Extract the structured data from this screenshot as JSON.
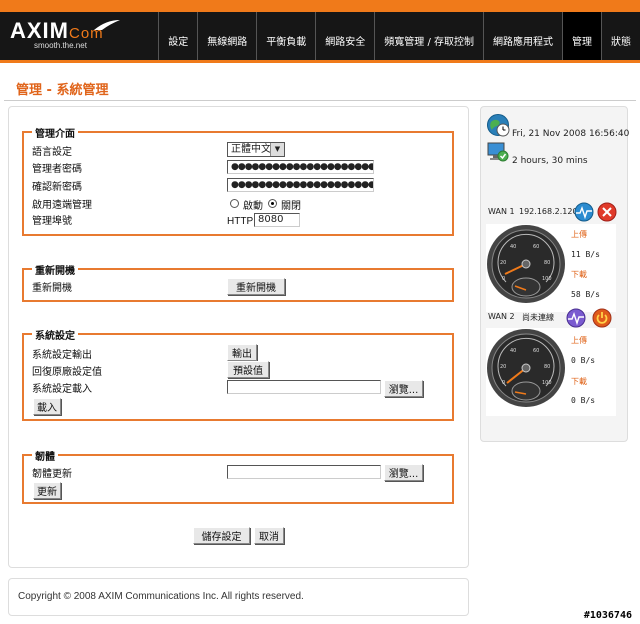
{
  "brand": {
    "name": "AXIM",
    "suffix": "Com",
    "tagline": "smooth.the.net"
  },
  "nav": [
    {
      "label": "設定"
    },
    {
      "label": "無線網路"
    },
    {
      "label": "平衡負載"
    },
    {
      "label": "網路安全"
    },
    {
      "label": "頻寬管理 / 存取控制"
    },
    {
      "label": "網路應用程式"
    },
    {
      "label": "管理",
      "active": true
    },
    {
      "label": "狀態"
    }
  ],
  "page_title": "管理 - 系統管理",
  "admin": {
    "legend": "管理介面",
    "language_label": "語言設定",
    "language_value": "正體中文",
    "password_label": "管理者密碼",
    "password_value": "●●●●●●●●●●●●●●●●●●●●●●●●●●●●●●●●",
    "confirm_label": "確認新密碼",
    "confirm_value": "●●●●●●●●●●●●●●●●●●●●●●●●●●●●●●●●",
    "remote_label": "啟用遠端管理",
    "remote_on": "啟動",
    "remote_off": "關閉",
    "port_label": "管理埠號",
    "port_prefix": "HTTP",
    "port_value": "8080"
  },
  "reboot": {
    "legend": "重新開機",
    "label": "重新開機",
    "button": "重新開機"
  },
  "syscfg": {
    "legend": "系統設定",
    "export_label": "系統設定輸出",
    "export_button": "輸出",
    "default_label": "回復原廠設定值",
    "default_button": "預設值",
    "import_label": "系統設定載入",
    "browse_button": "瀏覽...",
    "load_button": "載入"
  },
  "firmware": {
    "legend": "韌體",
    "label": "韌體更新",
    "browse_button": "瀏覽...",
    "update_button": "更新"
  },
  "actions": {
    "save": "儲存設定",
    "cancel": "取消"
  },
  "footer": "Copyright © 2008 AXIM Communications Inc. All rights reserved.",
  "status": {
    "datetime": "Fri, 21 Nov 2008 16:56:40",
    "uptime": "2 hours, 30 mins",
    "wan1": {
      "label": "WAN 1",
      "ip": "192.168.2.120",
      "up_label": "上傳",
      "up_value": "11 B/s",
      "down_label": "下載",
      "down_value": "58 B/s"
    },
    "wan2": {
      "label": "WAN 2",
      "ip": "尚未連線",
      "up_label": "上傳",
      "up_value": "0 B/s",
      "down_label": "下載",
      "down_value": "0 B/s"
    }
  },
  "gauge_ticks": [
    "0",
    "20",
    "40",
    "60",
    "80",
    "100"
  ],
  "watermark": "#1036746",
  "colors": {
    "accent": "#f07a1a",
    "header_bg": "#161616",
    "label_orange": "#e0641a"
  }
}
